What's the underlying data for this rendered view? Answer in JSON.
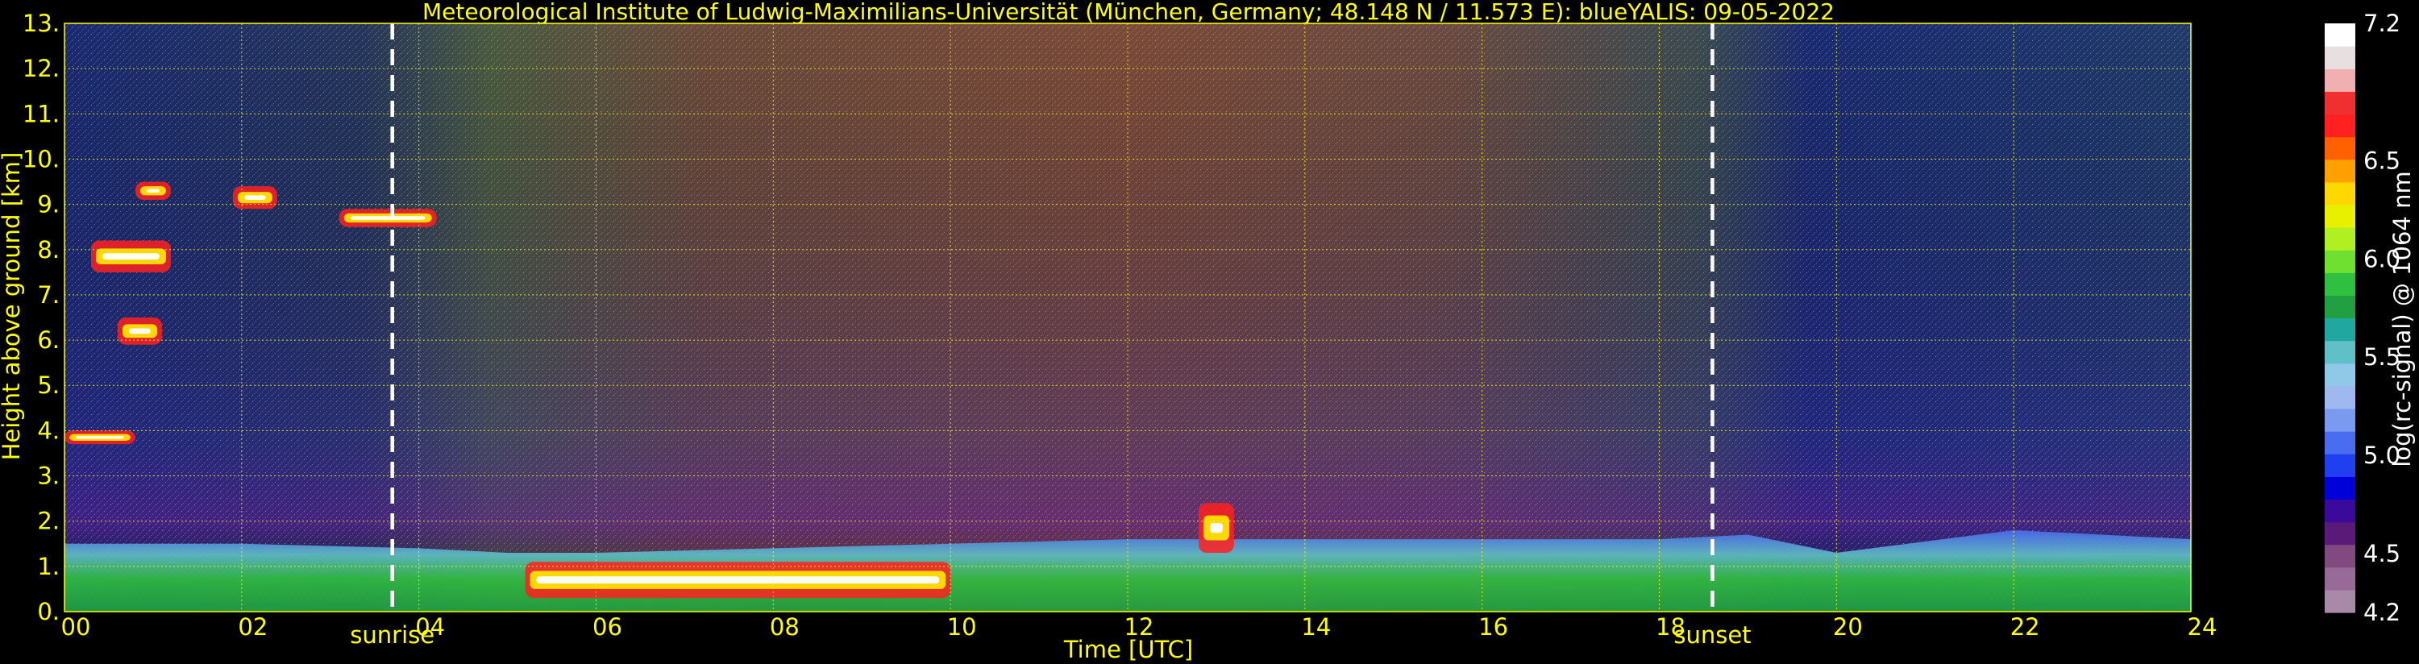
{
  "chart_data": {
    "type": "heatmap",
    "title": "Meteorological Institute of Ludwig-Maximilians-Universität (München, Germany; 48.148 N / 11.573 E):    blueYALIS: 09-05-2022",
    "xlabel": "Time [UTC]",
    "ylabel": "Height above ground [km]",
    "xlim": [
      0,
      24
    ],
    "ylim": [
      0,
      13
    ],
    "x_ticks": [
      0,
      2,
      4,
      6,
      8,
      10,
      12,
      14,
      16,
      18,
      20,
      22,
      24
    ],
    "x_tick_labels": [
      "00",
      "02",
      "04",
      "06",
      "08",
      "10",
      "12",
      "14",
      "16",
      "18",
      "20",
      "22",
      "24"
    ],
    "y_ticks": [
      0,
      1,
      2,
      3,
      4,
      5,
      6,
      7,
      8,
      9,
      10,
      11,
      12,
      13
    ],
    "y_tick_labels": [
      "0.",
      "1.",
      "2.",
      "3.",
      "4.",
      "5.",
      "6.",
      "7.",
      "8.",
      "9.",
      "10.",
      "11.",
      "12.",
      "13."
    ],
    "grid": true,
    "grid_color": "#ffff00",
    "background": "#000000",
    "annotations": [
      {
        "text": "sunrise",
        "x": 3.7
      },
      {
        "text": "sunset",
        "x": 18.6
      }
    ],
    "colorbar": {
      "label": "log(rc-signal) @ 1064 nm",
      "range": [
        4.2,
        7.2
      ],
      "ticks": [
        4.2,
        4.5,
        5.0,
        5.5,
        6.0,
        6.5,
        7.2
      ],
      "tick_labels": [
        "4.2",
        "4.5",
        "5.0",
        "5.5",
        "6.0",
        "6.5",
        "7.2"
      ],
      "colors": [
        "#a88aa8",
        "#986a98",
        "#804a80",
        "#5a1a78",
        "#3a0a9a",
        "#0000d8",
        "#2040f0",
        "#4a6cf0",
        "#7a9af0",
        "#a0b8f0",
        "#90c8e8",
        "#60c0c8",
        "#20a8a0",
        "#20a040",
        "#30c040",
        "#70e030",
        "#b0f020",
        "#e8f000",
        "#ffd800",
        "#ffa000",
        "#ff6000",
        "#ff2020",
        "#f03030",
        "#f0b0b0",
        "#e8e0e0",
        "#ffffff"
      ]
    },
    "boundary_layer_top_km": [
      [
        0,
        1.5
      ],
      [
        2,
        1.5
      ],
      [
        4,
        1.4
      ],
      [
        5,
        1.3
      ],
      [
        6,
        1.3
      ],
      [
        8,
        1.4
      ],
      [
        10,
        1.5
      ],
      [
        12,
        1.6
      ],
      [
        14,
        1.6
      ],
      [
        16,
        1.6
      ],
      [
        18,
        1.6
      ],
      [
        19,
        1.7
      ],
      [
        20,
        1.3
      ],
      [
        22,
        1.8
      ],
      [
        24,
        1.6
      ]
    ],
    "cloud_layers": [
      {
        "x": [
          0.8,
          1.2
        ],
        "y": [
          9.1,
          9.5
        ]
      },
      {
        "x": [
          1.9,
          2.4
        ],
        "y": [
          8.9,
          9.4
        ]
      },
      {
        "x": [
          3.1,
          4.2
        ],
        "y": [
          8.5,
          8.9
        ]
      },
      {
        "x": [
          0.3,
          1.2
        ],
        "y": [
          7.5,
          8.2
        ]
      },
      {
        "x": [
          0.6,
          1.1
        ],
        "y": [
          5.9,
          6.5
        ]
      },
      {
        "x": [
          0.0,
          0.8
        ],
        "y": [
          3.7,
          4.0
        ]
      },
      {
        "x": [
          5.2,
          10.0
        ],
        "y": [
          0.3,
          1.1
        ]
      },
      {
        "x": [
          12.8,
          13.2
        ],
        "y": [
          1.3,
          2.4
        ]
      }
    ]
  }
}
